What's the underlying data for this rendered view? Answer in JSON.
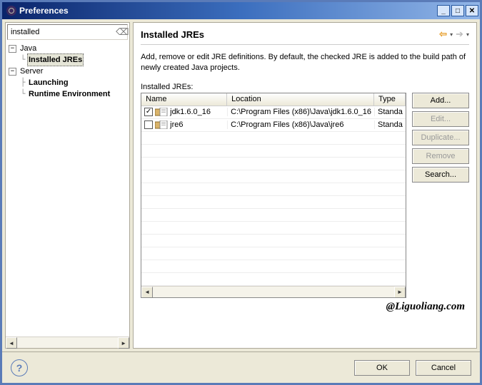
{
  "window": {
    "title": "Preferences"
  },
  "filter": {
    "value": "installed"
  },
  "tree": {
    "java": {
      "label": "Java",
      "expanded": true,
      "installed_jres": "Installed JREs"
    },
    "server": {
      "label": "Server",
      "expanded": true,
      "launching": "Launching",
      "runtime_env": "Runtime Environment"
    }
  },
  "page": {
    "title": "Installed JREs",
    "description": "Add, remove or edit JRE definitions. By default, the checked JRE is added to the build path of newly created Java projects.",
    "table_label": "Installed JREs:"
  },
  "columns": {
    "name": "Name",
    "location": "Location",
    "type": "Type"
  },
  "jres": [
    {
      "checked": true,
      "name": "jdk1.6.0_16",
      "location": "C:\\Program Files (x86)\\Java\\jdk1.6.0_16",
      "type": "Standa"
    },
    {
      "checked": false,
      "name": "jre6",
      "location": "C:\\Program Files (x86)\\Java\\jre6",
      "type": "Standa"
    }
  ],
  "buttons": {
    "add": "Add...",
    "edit": "Edit...",
    "duplicate": "Duplicate...",
    "remove": "Remove",
    "search": "Search...",
    "ok": "OK",
    "cancel": "Cancel"
  },
  "watermark": "@Liguoliang.com"
}
